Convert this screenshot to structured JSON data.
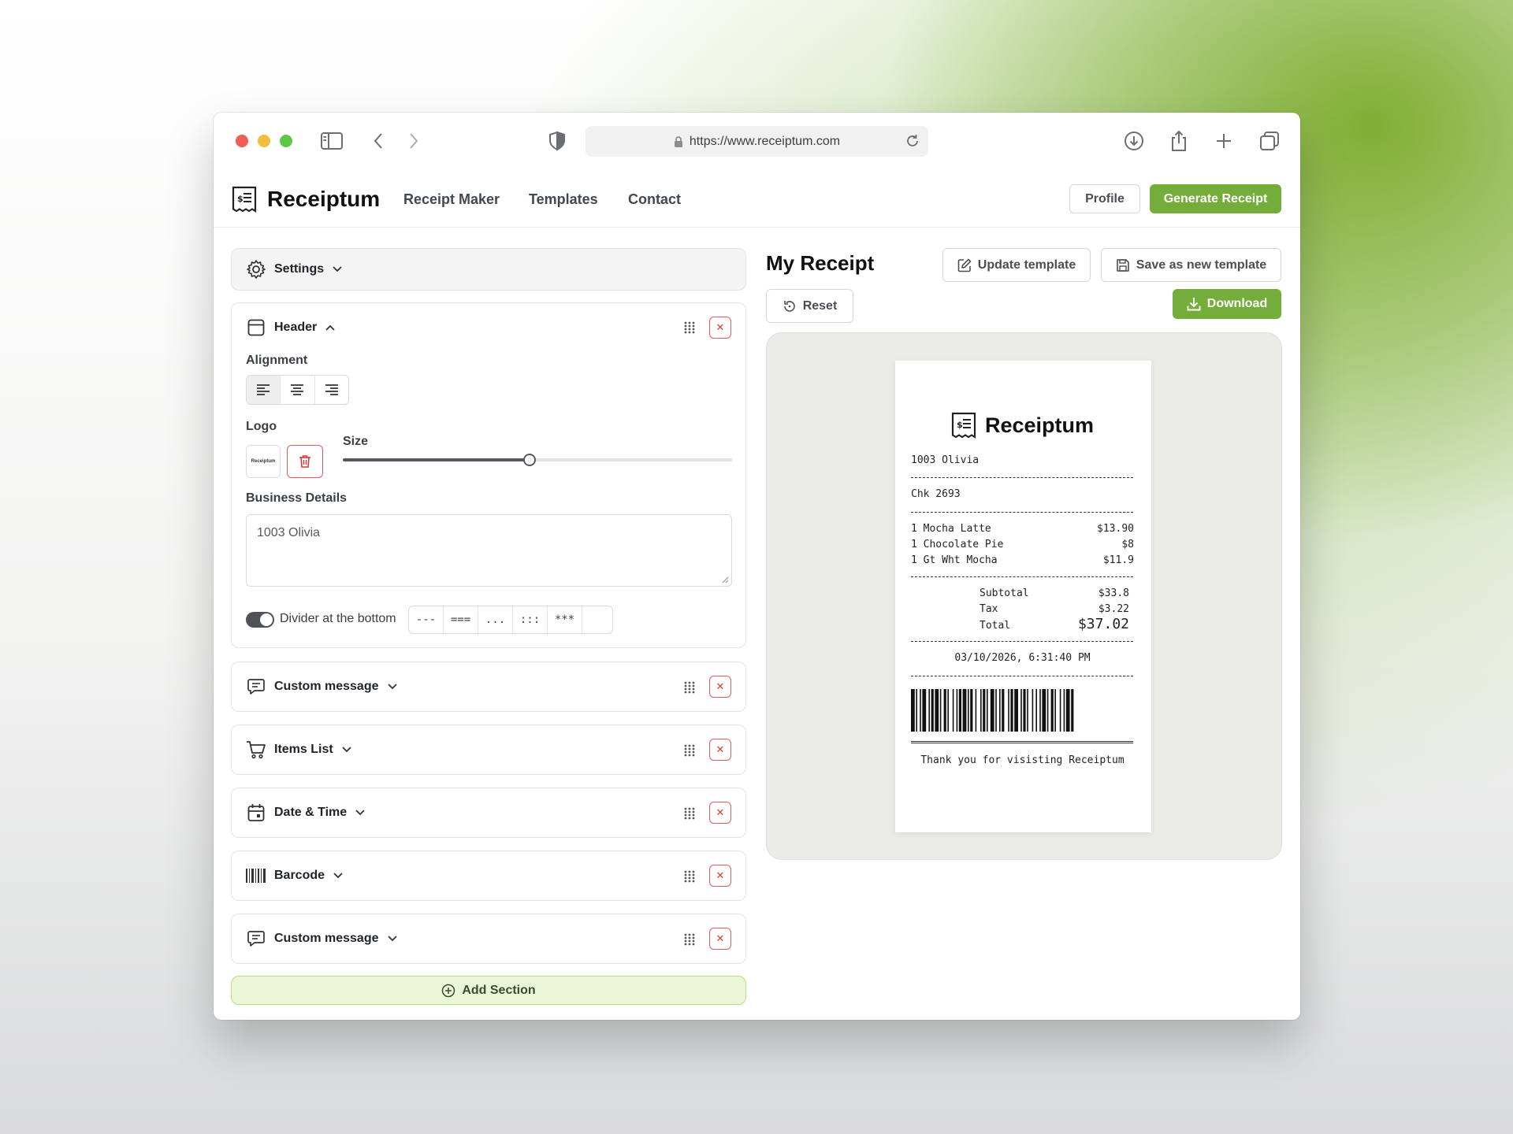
{
  "browser": {
    "url": "https://www.receiptum.com"
  },
  "nav": {
    "brand": "Receiptum",
    "links": [
      "Receipt Maker",
      "Templates",
      "Contact"
    ],
    "profile_label": "Profile",
    "generate_label": "Generate Receipt"
  },
  "settings": {
    "label": "Settings"
  },
  "header_section": {
    "title": "Header",
    "alignment_label": "Alignment",
    "logo_label": "Logo",
    "logo_thumb_text": "Receiptum",
    "size_label": "Size",
    "size_value": 0.48,
    "business_label": "Business Details",
    "business_value": "1003 Olivia",
    "divider_label": "Divider at the bottom",
    "divider_on": true,
    "divider_options": [
      "---",
      "===",
      "...",
      ":::",
      "***",
      ""
    ]
  },
  "sections": [
    {
      "title": "Custom message",
      "icon": "message-icon"
    },
    {
      "title": "Items List",
      "icon": "cart-icon"
    },
    {
      "title": "Date & Time",
      "icon": "calendar-icon"
    },
    {
      "title": "Barcode",
      "icon": "barcode-icon"
    },
    {
      "title": "Custom message",
      "icon": "message-icon"
    }
  ],
  "add_section_label": "Add Section",
  "preview": {
    "title": "My Receipt",
    "update_template_label": "Update template",
    "save_template_label": "Save as new template",
    "reset_label": "Reset",
    "download_label": "Download"
  },
  "receipt": {
    "brand": "Receiptum",
    "business": "1003 Olivia",
    "check": "Chk 2693",
    "items": [
      {
        "name": "1 Mocha Latte",
        "price": "$13.90"
      },
      {
        "name": "1 Chocolate Pie",
        "price": "$8"
      },
      {
        "name": "1 Gt Wht Mocha",
        "price": "$11.9"
      }
    ],
    "subtotal_label": "Subtotal",
    "subtotal": "$33.8",
    "tax_label": "Tax",
    "tax": "$3.22",
    "total_label": "Total",
    "total": "$37.02",
    "datetime": "03/10/2026, 6:31:40 PM",
    "footer": "Thank you for visisting Receiptum"
  },
  "colors": {
    "accent": "#75ad3b",
    "danger": "#d63b3b",
    "add_bg": "#eaf6d6"
  }
}
